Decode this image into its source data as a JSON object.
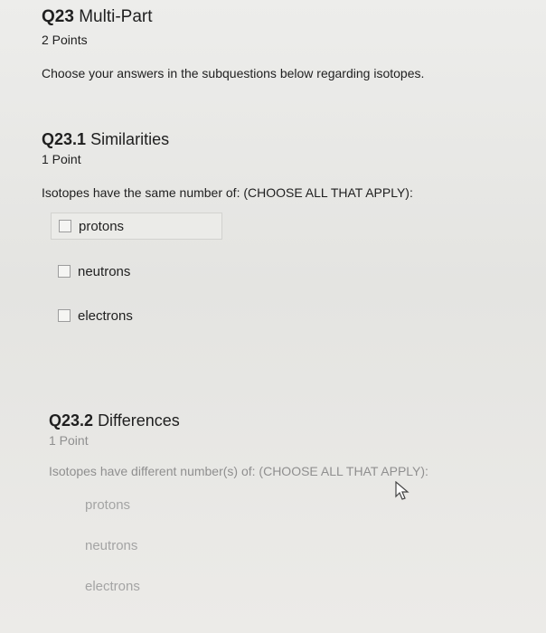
{
  "question": {
    "number": "Q23",
    "title": "Multi-Part",
    "points": "2 Points",
    "prompt": "Choose your answers in the subquestions below regarding isotopes."
  },
  "sub1": {
    "number": "Q23.1",
    "title": "Similarities",
    "points": "1 Point",
    "prompt": "Isotopes have the same number of: (CHOOSE ALL THAT APPLY):",
    "options": [
      "protons",
      "neutrons",
      "electrons"
    ]
  },
  "sub2": {
    "number": "Q23.2",
    "title": "Differences",
    "points": "1 Point",
    "prompt": "Isotopes have different number(s) of: (CHOOSE ALL THAT APPLY):",
    "options": [
      "protons",
      "neutrons",
      "electrons"
    ]
  },
  "icons": {
    "cursor": "mouse-pointer-icon"
  }
}
